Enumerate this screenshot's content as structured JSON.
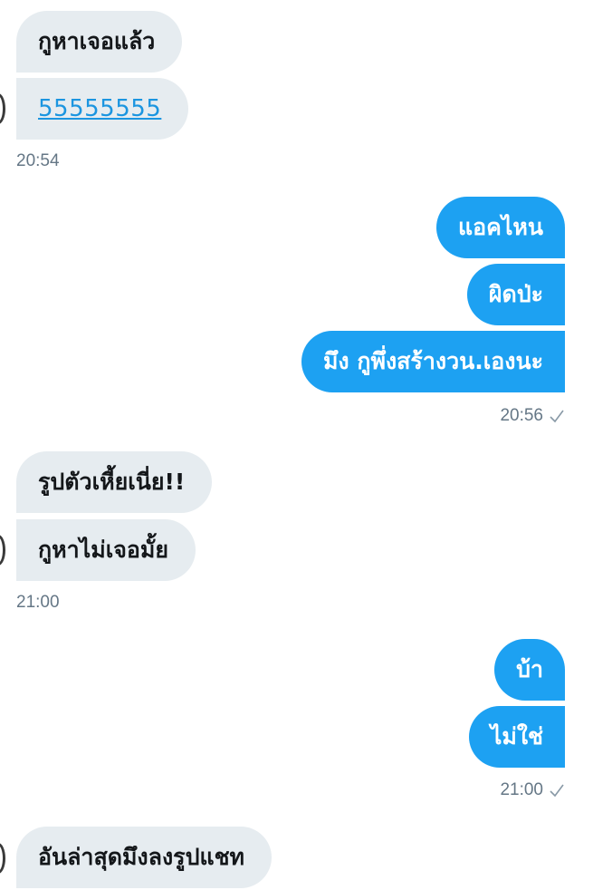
{
  "messages": [
    {
      "sender": "them",
      "text": "กูหาเจอแล้ว"
    },
    {
      "sender": "them",
      "text": "55555555",
      "is_link": true
    },
    {
      "sender": "me",
      "text": "แอคไหน"
    },
    {
      "sender": "me",
      "text": "ผิดป่ะ"
    },
    {
      "sender": "me",
      "text": "มึง กูพึ่งสร้างวน.เองนะ"
    },
    {
      "sender": "them",
      "text": "รูปตัวเหี้ยเนี่ย!!"
    },
    {
      "sender": "them",
      "text": "กูหาไม่เจอมั้ย"
    },
    {
      "sender": "me",
      "text": "บ้า"
    },
    {
      "sender": "me",
      "text": "ไม่ใช่"
    },
    {
      "sender": "them",
      "text": "อันล่าสุดมึงลงรูปแชท"
    }
  ],
  "timestamps": {
    "t1": "20:54",
    "t2": "20:56",
    "t3": "21:00",
    "t4": "21:00"
  },
  "colors": {
    "incoming_bubble": "#e6ecf0",
    "outgoing_bubble": "#1da1f2",
    "link": "#1b95e0",
    "timestamp": "#657786"
  },
  "icons": {
    "sent_status": "checkmark-icon",
    "avatar": "avatar-icon"
  }
}
